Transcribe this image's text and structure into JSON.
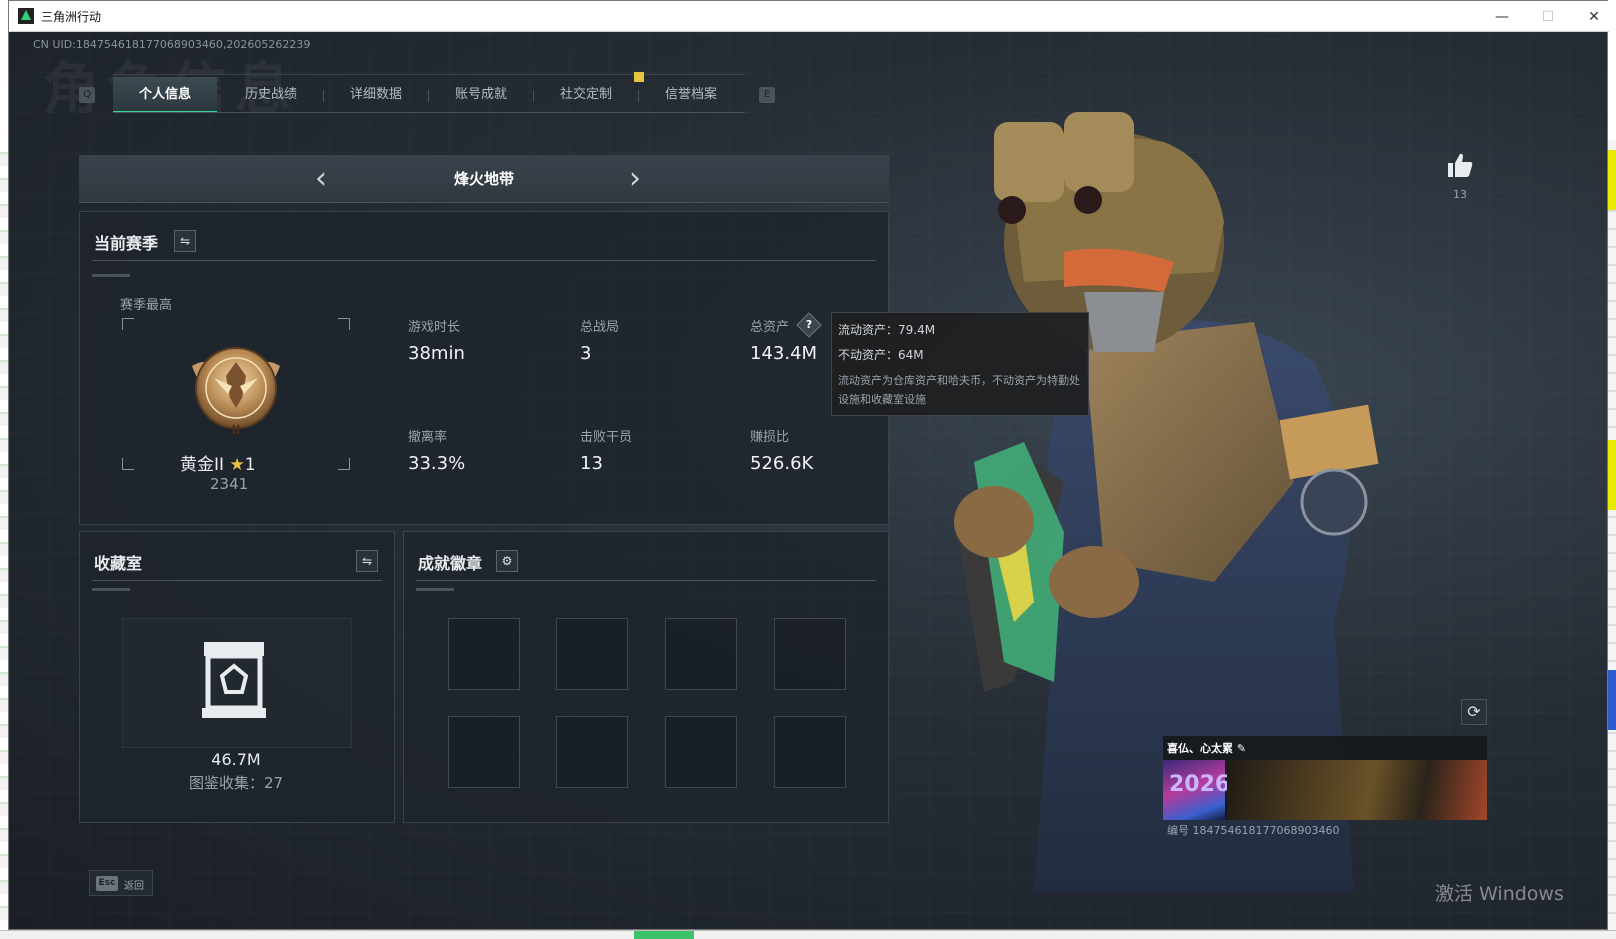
{
  "window": {
    "title": "三角洲行动",
    "minimize": "—",
    "maximize": "☐",
    "close": "✕"
  },
  "uid": "CN UID:184754618177068903460,202605262239",
  "bg_title": "角色信息",
  "tabs": {
    "left_key": "Q",
    "right_key": "E",
    "items": [
      {
        "label": "个人信息",
        "active": true
      },
      {
        "label": "历史战绩",
        "active": false
      },
      {
        "label": "详细数据",
        "active": false
      },
      {
        "label": "账号成就",
        "active": false
      },
      {
        "label": "社交定制",
        "active": false
      },
      {
        "label": "信誉档案",
        "active": false
      }
    ]
  },
  "mode": {
    "title": "烽火地带",
    "prev": "‹",
    "next": "›"
  },
  "season": {
    "header": "当前赛季",
    "swap_icon": "⇋",
    "best_label": "赛季最高",
    "rank": "黄金II",
    "rank_star": "★",
    "rank_star_count": "1",
    "score": "2341",
    "stats": [
      {
        "label": "游戏时长",
        "value": "38min"
      },
      {
        "label": "总战局",
        "value": "3"
      },
      {
        "label": "总资产",
        "value": "143.4M"
      },
      {
        "label": "撤离率",
        "value": "33.3%"
      },
      {
        "label": "击败干员",
        "value": "13"
      },
      {
        "label": "赚损比",
        "value": "526.6K"
      }
    ],
    "help_icon": "?"
  },
  "tooltip": {
    "liquid": "流动资产：79.4M",
    "fixed": "不动资产：64M",
    "desc": "流动资产为仓库资产和哈夫币，不动资产为特勤处设施和收藏室设施"
  },
  "collection": {
    "header": "收藏室",
    "swap_icon": "⇋",
    "value": "46.7M",
    "sub": "图鉴收集：27"
  },
  "achievements": {
    "header": "成就徽章",
    "gear_icon": "⚙"
  },
  "profile": {
    "likes": "13",
    "name": "喜仏、心太累",
    "edit_icon": "✎",
    "avatar_text": "2026",
    "id_text": "编号 184754618177068903460",
    "refresh_icon": "⟳"
  },
  "footer": {
    "esc_key": "Esc",
    "back": "返回",
    "activate": "激活 Windows"
  },
  "colors": {
    "accent": "#37d399",
    "gold": "#e7c342",
    "panel": "#1e252c"
  }
}
